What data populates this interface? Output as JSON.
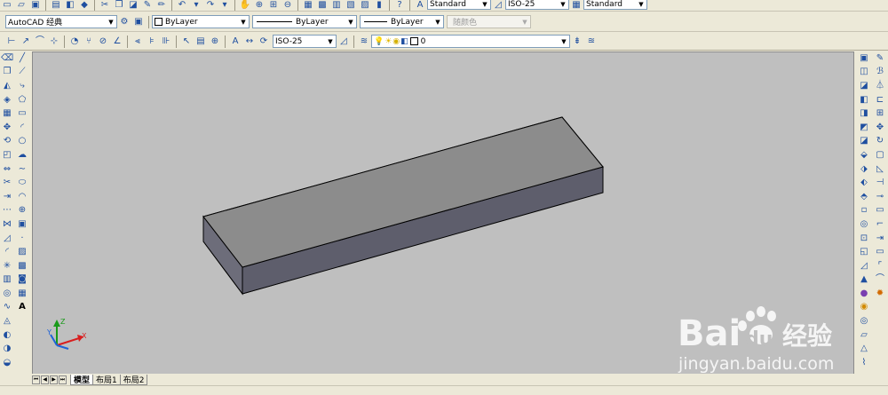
{
  "top_toolbar": {
    "text_style": "Standard",
    "dim_style": "ISO-25",
    "table_style": "Standard"
  },
  "workspace": {
    "selected": "AutoCAD 经典"
  },
  "properties": {
    "color": "ByLayer",
    "linetype": "ByLayer",
    "lineweight": "ByLayer",
    "plot_style": "随颜色"
  },
  "dim_toolbar": {
    "dim_style": "ISO-25"
  },
  "layer": {
    "current": "0"
  },
  "ucs": {
    "x": "X",
    "y": "Y",
    "z": "Z"
  },
  "layout_tabs": [
    {
      "label": "模型",
      "active": true
    },
    {
      "label": "布局1",
      "active": false
    },
    {
      "label": "布局2",
      "active": false
    }
  ],
  "watermark": {
    "brand": "Bai",
    "brand2": "du",
    "cn": "经验",
    "url": "jingyan.baidu.com"
  },
  "colors": {
    "viewport_bg": "#bfbfbf",
    "box_top": "#8c8c8c",
    "box_front": "#5f5f6c",
    "box_side": "#6f6f7c"
  }
}
